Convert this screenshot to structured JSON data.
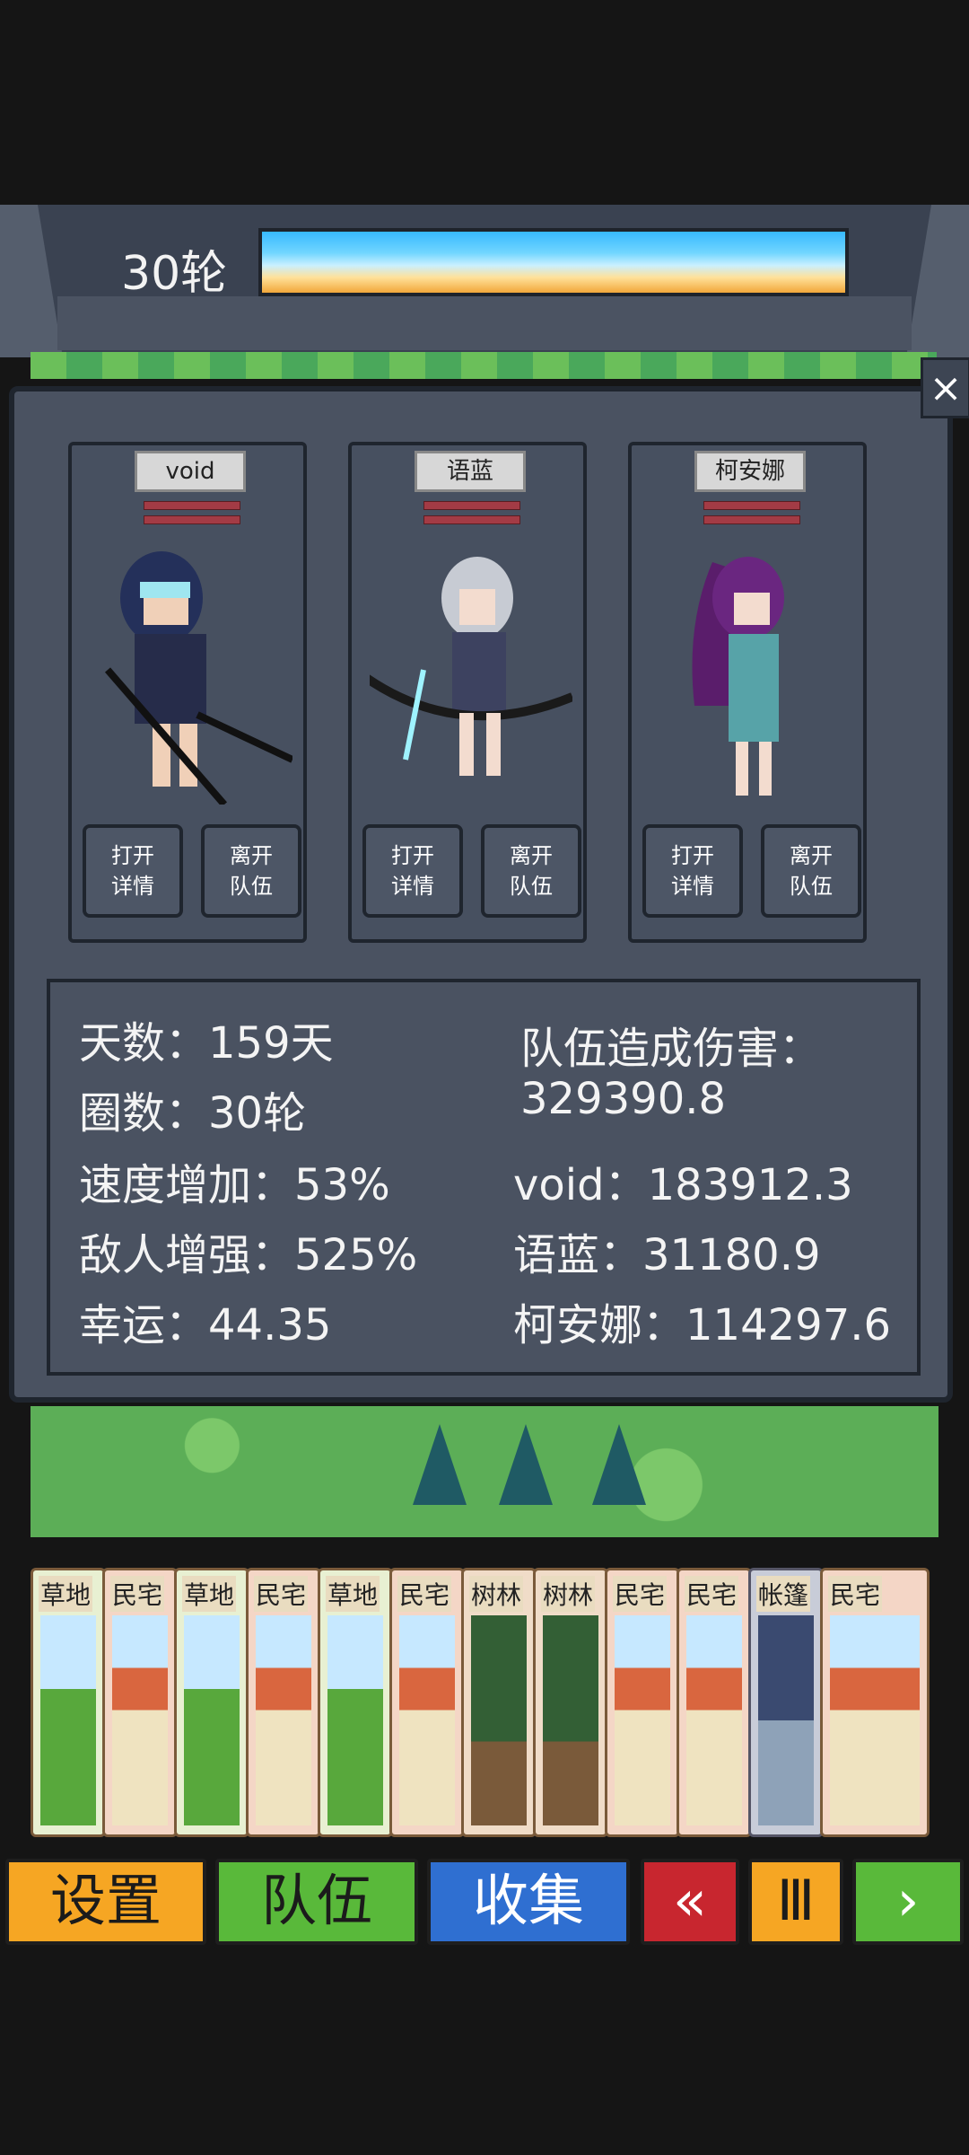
{
  "round": {
    "label": "30轮"
  },
  "close": {
    "icon": "close-icon",
    "glyph": "×"
  },
  "members": [
    {
      "name": "void",
      "open_line1": "打开",
      "open_line2": "详情",
      "leave_line1": "离开",
      "leave_line2": "队伍"
    },
    {
      "name": "语蓝",
      "open_line1": "打开",
      "open_line2": "详情",
      "leave_line1": "离开",
      "leave_line2": "队伍"
    },
    {
      "name": "柯安娜",
      "open_line1": "打开",
      "open_line2": "详情",
      "leave_line1": "离开",
      "leave_line2": "队伍"
    }
  ],
  "stats": {
    "days": "天数：159天",
    "laps": "圈数：30轮",
    "speed": "速度增加：53%",
    "enemy": "敌人增强：525%",
    "luck": "幸运：44.35",
    "team_damage_label": "队伍造成伤害：",
    "team_damage_value": "329390.8",
    "void_damage": "void：183912.3",
    "yulan_damage": "语蓝：31180.9",
    "keanna_damage": "柯安娜：114297.6"
  },
  "cards": [
    "草地",
    "民宅",
    "草地",
    "民宅",
    "草地",
    "民宅",
    "树林",
    "树林",
    "民宅",
    "民宅",
    "帐篷",
    "民宅"
  ],
  "nav": {
    "settings": "设置",
    "team": "队伍",
    "collect": "收集",
    "rewind": "«",
    "pause": "Ⅲ",
    "play": "›"
  },
  "colors": {
    "settings": "#f6a623",
    "team": "#59b93a",
    "collect": "#2f6fd1",
    "rewind": "#c8262f",
    "pause": "#f6a623",
    "play": "#59b93a"
  }
}
